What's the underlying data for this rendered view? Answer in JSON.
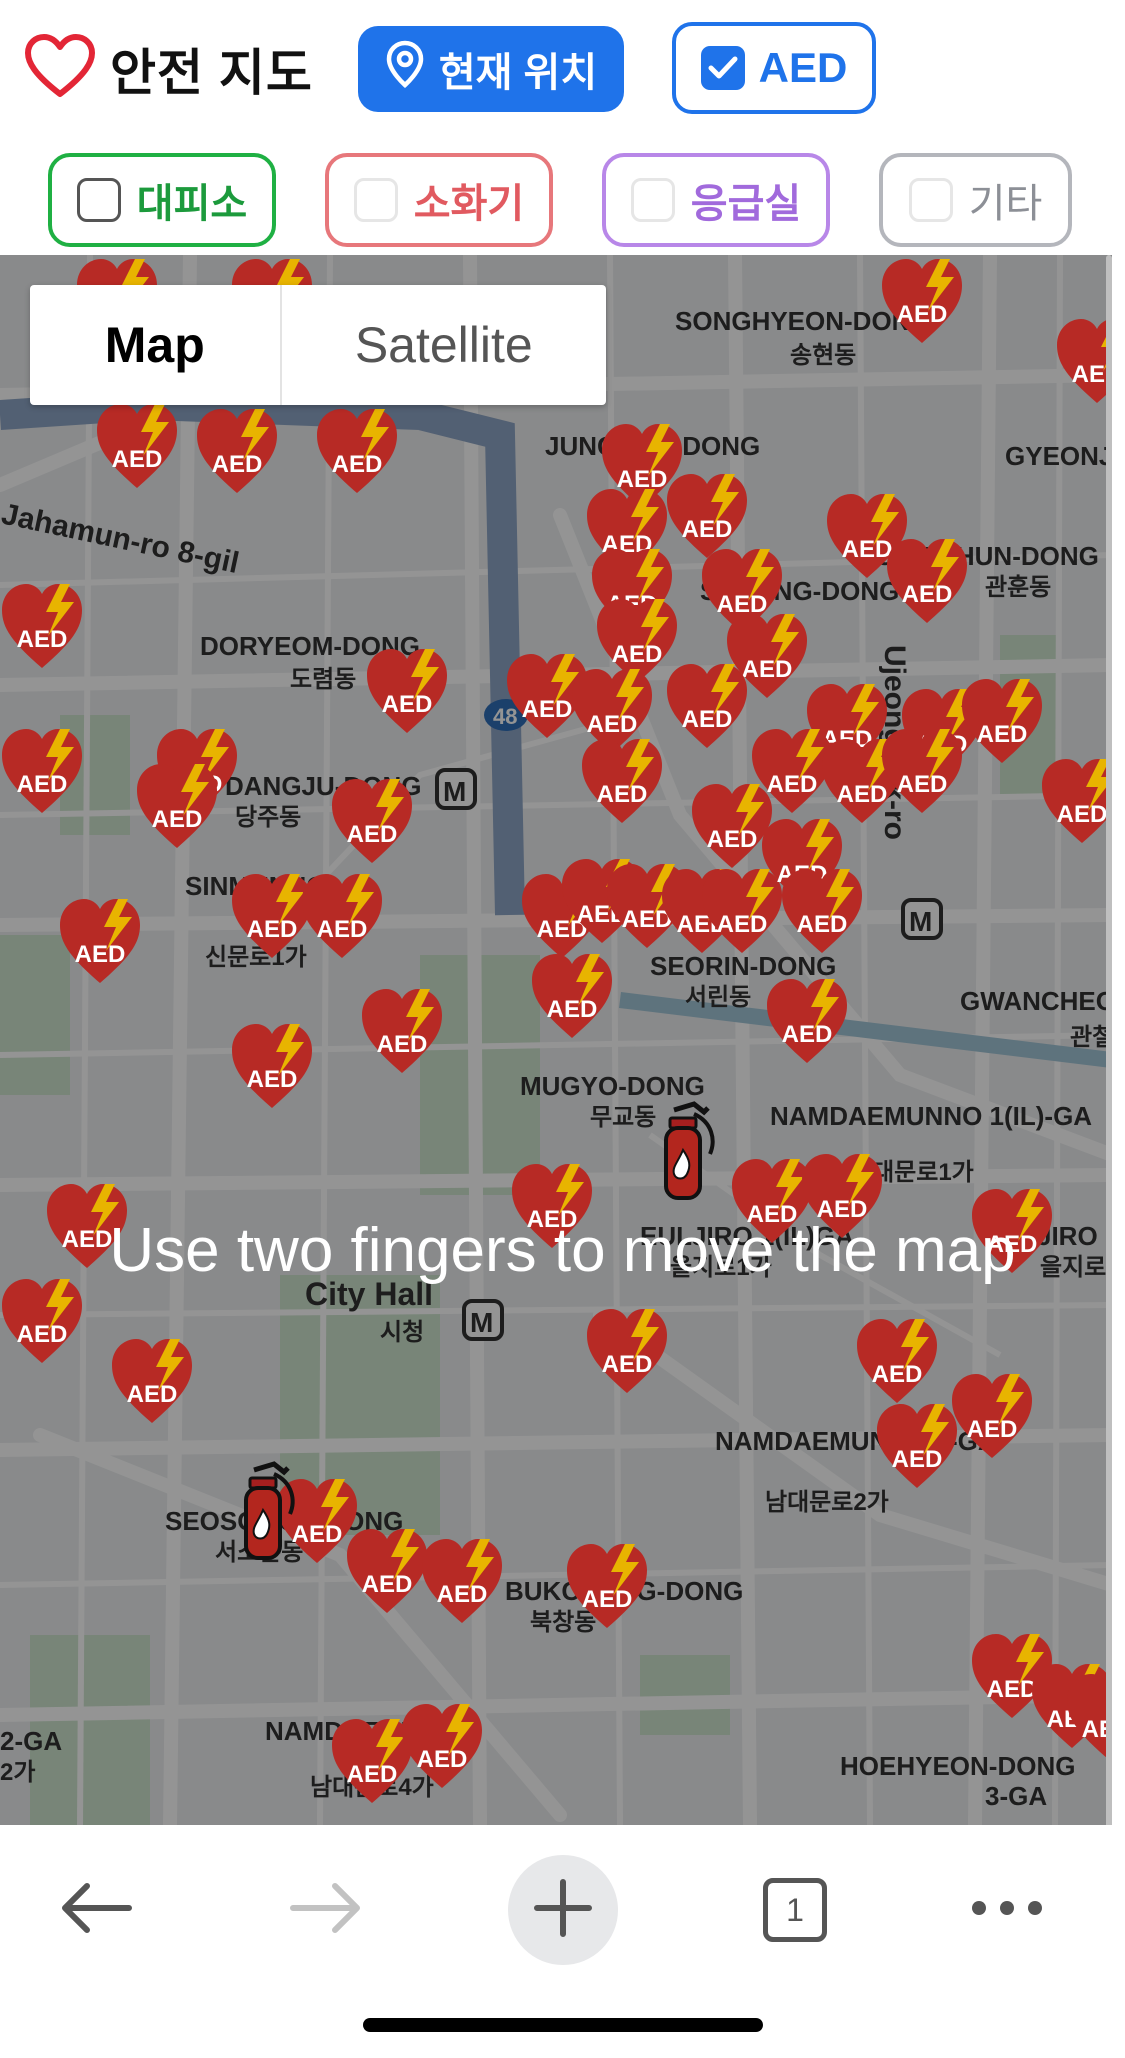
{
  "header": {
    "app_title": "안전 지도",
    "current_location_label": "현재 위치",
    "aed_toggle_label": "AED",
    "aed_toggle_checked": true
  },
  "filters": [
    {
      "label": "대피소",
      "color": "#1fb043",
      "checked": false
    },
    {
      "label": "소화기",
      "color": "#e7777b",
      "checked": false
    },
    {
      "label": "응급실",
      "color": "#b887e8",
      "checked": false
    },
    {
      "label": "기타",
      "color": "#b4b6bc",
      "checked": false
    }
  ],
  "map": {
    "type_options": [
      "Map",
      "Satellite"
    ],
    "selected_type": "Map",
    "gesture_hint": "Use two fingers to move the map",
    "marker_label": "AED",
    "places": [
      "SONGHYEON-DONG",
      "송현동",
      "JUNGHAK-DONG",
      "GYEONJI",
      "SUSONG-DONG",
      "GWANHUN-DONG",
      "관훈동",
      "DORYEOM-DONG",
      "도렴동",
      "DANGJU-DONG",
      "당주동",
      "SINMUNNO",
      "신문로1가",
      "SEORIN-DONG",
      "서린동",
      "GWANCHEOL",
      "관철",
      "MUGYO-DONG",
      "무교동",
      "NAMDAEMUNNO 1(IL)-GA",
      "남대문로1가",
      "EULJIRO 1(IL)GA",
      "을지로1가",
      "EULJIRO",
      "을지로",
      "City Hall",
      "시청",
      "NAMDAEMUNNO 2-GA",
      "남대문로2가",
      "SEOSOMUN-DONG",
      "서소문동",
      "BUKCHANG-DONG",
      "북창동",
      "NAMDAEMUNNO",
      "남대문로4가",
      "HOEHYEON-DONG",
      "3-GA",
      "2-GA",
      "2가",
      "Jahamun-ro 8-gil",
      "Ujeongguk-ro"
    ],
    "route_number": "48",
    "marker_color": "#b72a25"
  },
  "browser": {
    "tab_count": "1"
  }
}
